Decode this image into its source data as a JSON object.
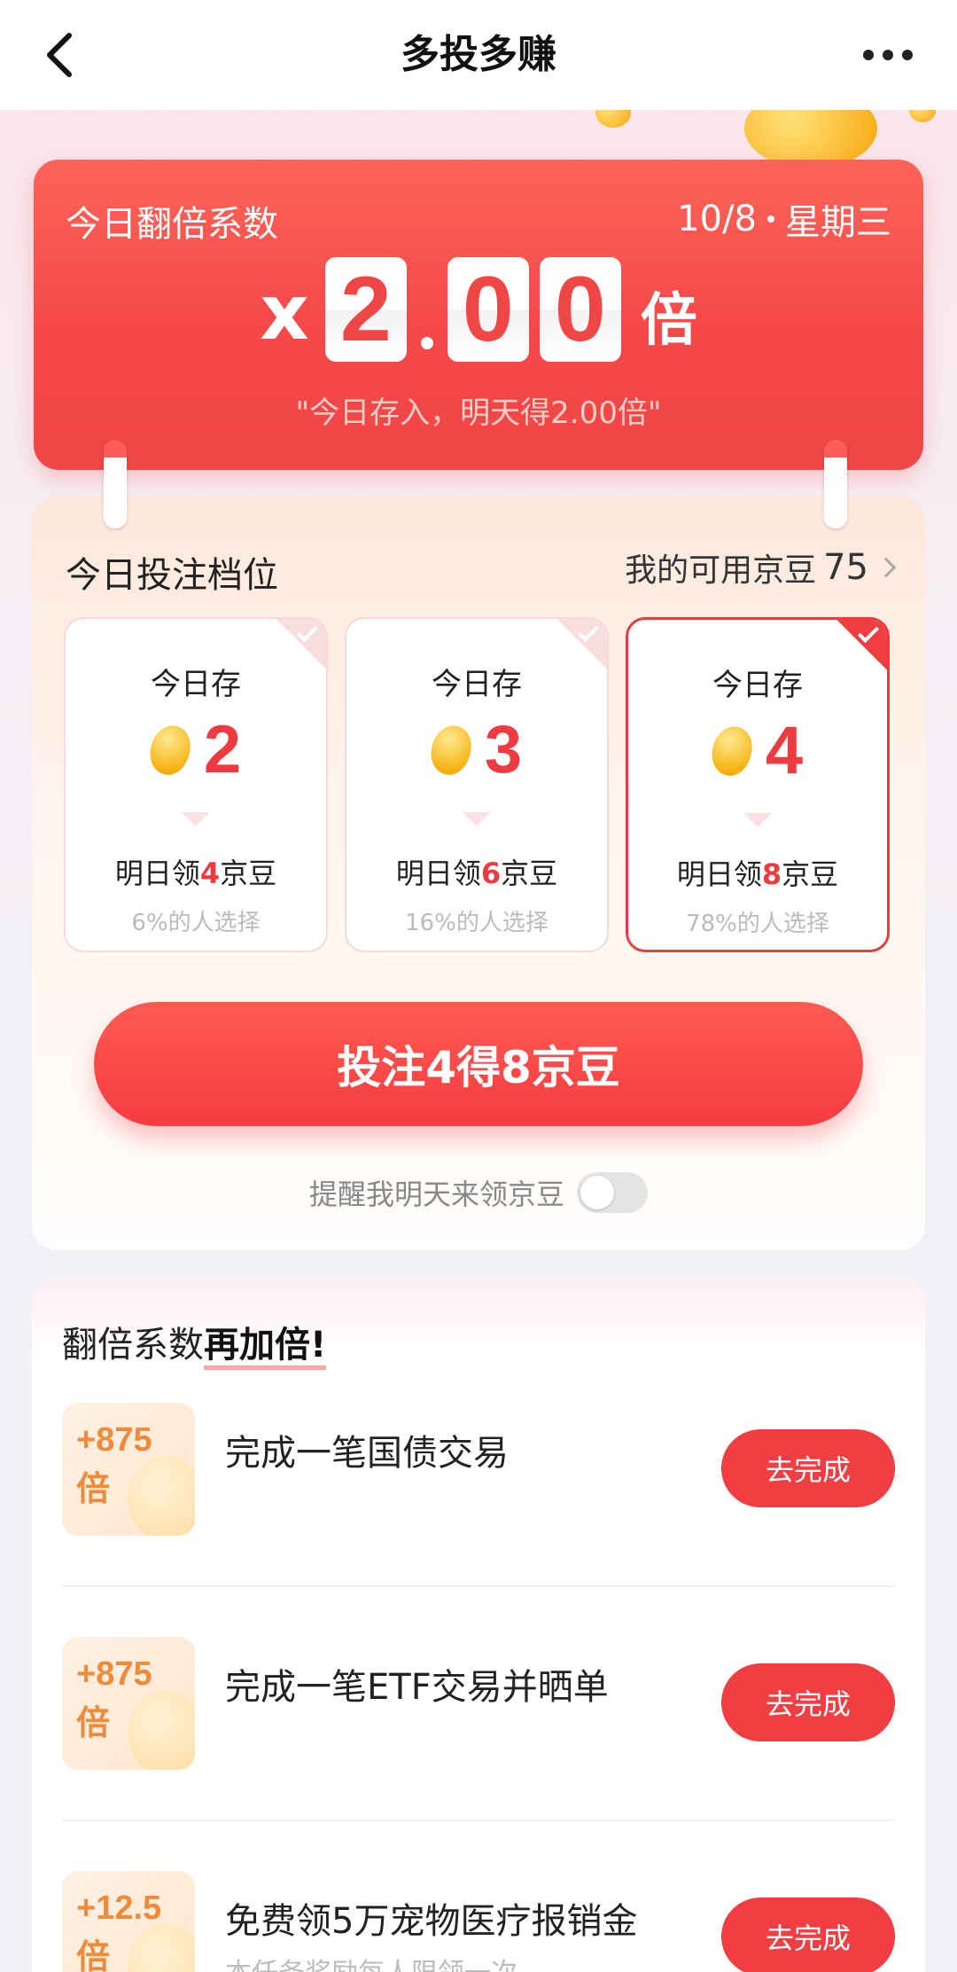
{
  "header": {
    "title": "多投多赚"
  },
  "banner": {
    "label": "今日翻倍系数",
    "date": "10/8",
    "weekday": "星期三",
    "mult_prefix": "x",
    "digits": [
      "2",
      "0",
      "0"
    ],
    "mult_unit": "倍",
    "note": "\"今日存入，明天得2.00倍\""
  },
  "bet": {
    "title": "今日投注档位",
    "beans_label": "我的可用京豆",
    "beans_count": "75",
    "tiers": [
      {
        "label": "今日存",
        "amount": "2",
        "reward_prefix": "明日领",
        "reward_value": "4",
        "reward_suffix": "京豆",
        "pct": "6%的人选择",
        "selected": false
      },
      {
        "label": "今日存",
        "amount": "3",
        "reward_prefix": "明日领",
        "reward_value": "6",
        "reward_suffix": "京豆",
        "pct": "16%的人选择",
        "selected": false
      },
      {
        "label": "今日存",
        "amount": "4",
        "reward_prefix": "明日领",
        "reward_value": "8",
        "reward_suffix": "京豆",
        "pct": "78%的人选择",
        "selected": true
      }
    ],
    "cta": "投注4得8京豆",
    "remind_text": "提醒我明天来领京豆",
    "remind_on": false
  },
  "tasks": {
    "title_prefix": "翻倍系数",
    "title_emph": "再加倍!",
    "items": [
      {
        "badge_top": "+875",
        "badge_bottom": "倍",
        "name": "完成一笔国债交易",
        "sub": "",
        "button": "去完成"
      },
      {
        "badge_top": "+875",
        "badge_bottom": "倍",
        "name": "完成一笔ETF交易并晒单",
        "sub": "",
        "button": "去完成"
      },
      {
        "badge_top": "+12.5",
        "badge_bottom": "倍",
        "name": "免费领5万宠物医疗报销金",
        "sub": "本任务奖励每人限领一次",
        "button": "去完成"
      }
    ]
  },
  "colors": {
    "accent": "#f23d43",
    "badge_text": "#ee8a3b"
  }
}
